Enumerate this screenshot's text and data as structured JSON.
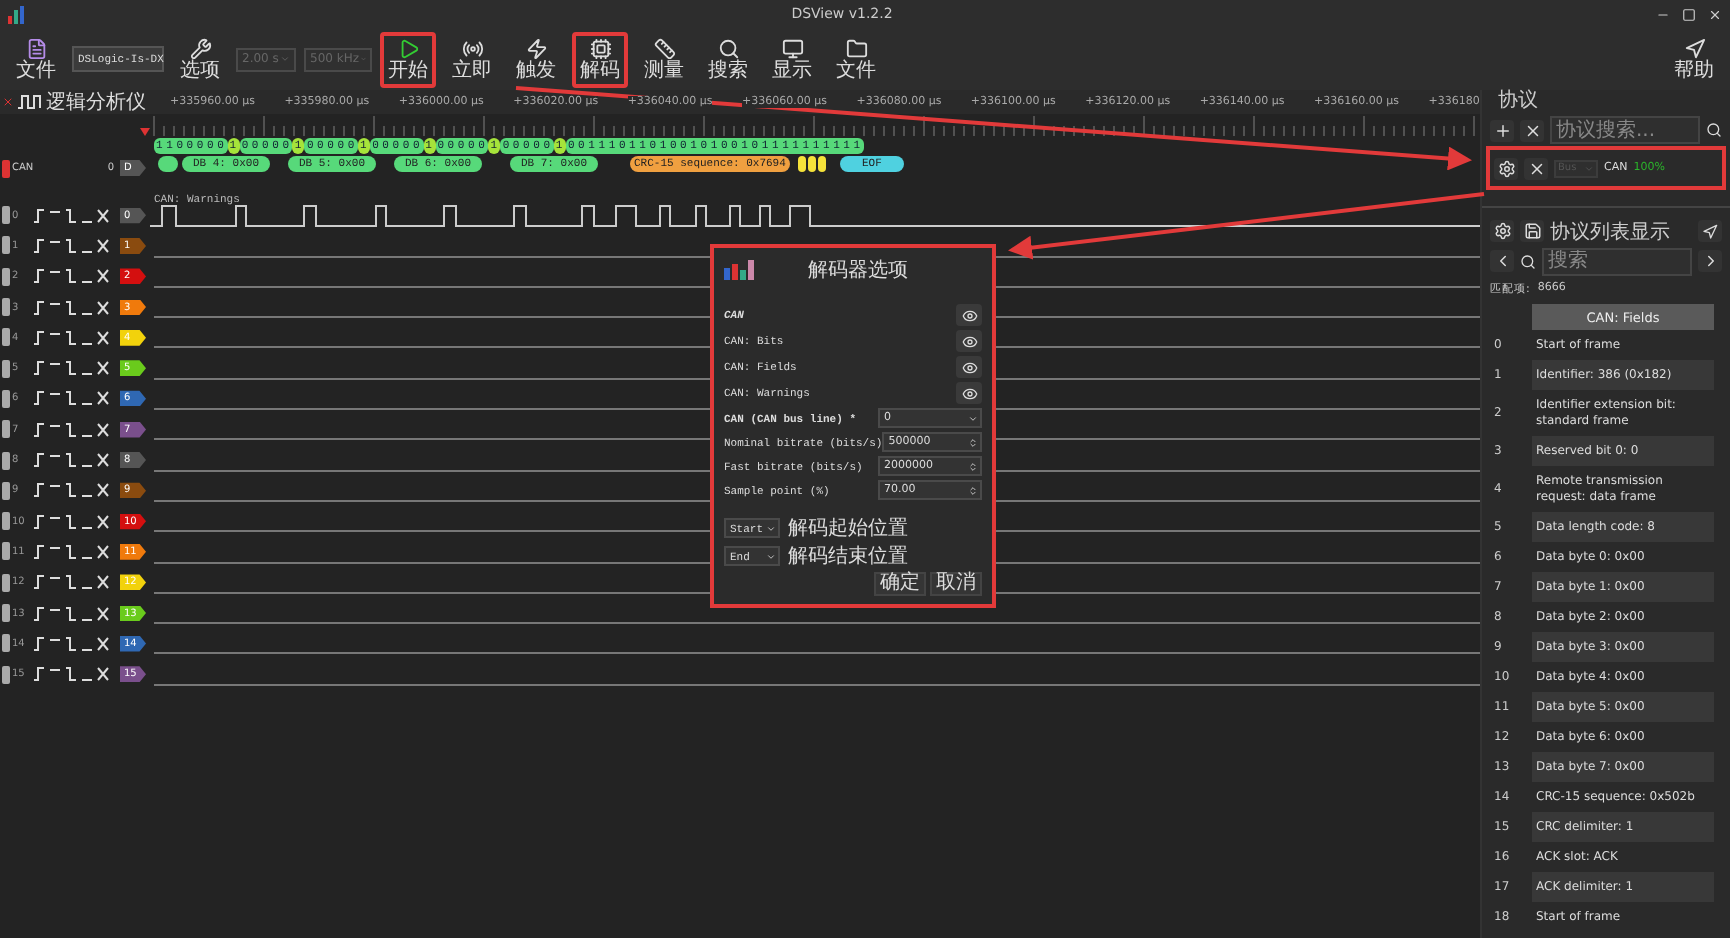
{
  "window": {
    "title": "DSView v1.2.2"
  },
  "toolbar": {
    "file": {
      "label": "文件"
    },
    "device": {
      "value": "DSLogic-Is-DX"
    },
    "options": {
      "label": "选项"
    },
    "duration": {
      "value": "2.00 s",
      "disabled": true
    },
    "rate": {
      "value": "500 kHz",
      "disabled": true
    },
    "buttons": [
      {
        "kind": "start",
        "label": "开始",
        "annotated": true
      },
      {
        "kind": "instant",
        "label": "立即",
        "annotated": false
      },
      {
        "kind": "trigger",
        "label": "触发",
        "annotated": false
      },
      {
        "kind": "decode",
        "label": "解码",
        "annotated": true
      },
      {
        "kind": "measure",
        "label": "测量",
        "annotated": false
      },
      {
        "kind": "search",
        "label": "搜索",
        "annotated": false
      },
      {
        "kind": "display",
        "label": "显示",
        "annotated": false
      },
      {
        "kind": "file",
        "label": "文件",
        "annotated": false
      }
    ],
    "help": {
      "label": "帮助"
    }
  },
  "mode_tab": {
    "label": "逻辑分析仪"
  },
  "ruler": {
    "labels": [
      "+335960.00 μs",
      "+335980.00 μs",
      "+336000.00 μs",
      "+336020.00 μs",
      "+336040.00 μs",
      "+336060.00 μs",
      "+336080.00 μs",
      "+336100.00 μs",
      "+336120.00 μs",
      "+336140.00 μs",
      "+336160.00 μs",
      "+336180"
    ]
  },
  "decoder_trace": {
    "name": "CAN",
    "channel": "0",
    "tag": "D",
    "warnings_label": "CAN: Warnings",
    "bits": [
      {
        "text": "1100000",
        "stuff": false
      },
      {
        "text": "1",
        "stuff": true
      },
      {
        "text": "00000",
        "stuff": false
      },
      {
        "text": "1",
        "stuff": true
      },
      {
        "text": "00000",
        "stuff": false
      },
      {
        "text": "1",
        "stuff": true
      },
      {
        "text": "00000",
        "stuff": false
      },
      {
        "text": "1",
        "stuff": true
      },
      {
        "text": "00000",
        "stuff": false
      },
      {
        "text": "1",
        "stuff": true
      },
      {
        "text": "00000",
        "stuff": false
      },
      {
        "text": "1",
        "stuff": true
      },
      {
        "text": "00111011010010100101111111111",
        "stuff": false
      }
    ],
    "fields": [
      {
        "kind": "dot"
      },
      {
        "kind": "data",
        "text": "DB 4: 0x00"
      },
      {
        "kind": "data",
        "text": "DB 5: 0x00"
      },
      {
        "kind": "data",
        "text": "DB 6: 0x00"
      },
      {
        "kind": "data",
        "text": "DB 7: 0x00"
      },
      {
        "kind": "crc",
        "text": "CRC-15 sequence: 0x7694"
      },
      {
        "kind": "delim"
      },
      {
        "kind": "delim"
      },
      {
        "kind": "delim"
      },
      {
        "kind": "eof",
        "text": "EOF"
      }
    ]
  },
  "channels": [
    {
      "number": "0",
      "tag": "0",
      "color": "#555555",
      "kind": "signal"
    },
    {
      "number": "1",
      "tag": "1",
      "color": "#8a4b0f",
      "kind": "flat"
    },
    {
      "number": "2",
      "tag": "2",
      "color": "#d40f0f",
      "kind": "flat"
    },
    {
      "number": "3",
      "tag": "3",
      "color": "#f07a0c",
      "kind": "flat"
    },
    {
      "number": "4",
      "tag": "4",
      "color": "#f2d20c",
      "kind": "flat"
    },
    {
      "number": "5",
      "tag": "5",
      "color": "#6acb1c",
      "kind": "flat"
    },
    {
      "number": "6",
      "tag": "6",
      "color": "#2f68b3",
      "kind": "flat"
    },
    {
      "number": "7",
      "tag": "7",
      "color": "#7a4f8c",
      "kind": "flat"
    },
    {
      "number": "8",
      "tag": "8",
      "color": "#555555",
      "kind": "flat"
    },
    {
      "number": "9",
      "tag": "9",
      "color": "#8a4b0f",
      "kind": "flat"
    },
    {
      "number": "10",
      "tag": "10",
      "color": "#d40f0f",
      "kind": "flat"
    },
    {
      "number": "11",
      "tag": "11",
      "color": "#f07a0c",
      "kind": "flat"
    },
    {
      "number": "12",
      "tag": "12",
      "color": "#f2d20c",
      "kind": "flat"
    },
    {
      "number": "13",
      "tag": "13",
      "color": "#6acb1c",
      "kind": "flat"
    },
    {
      "number": "14",
      "tag": "14",
      "color": "#2f68b3",
      "kind": "flat"
    },
    {
      "number": "15",
      "tag": "15",
      "color": "#7a4f8c",
      "kind": "flat"
    }
  ],
  "decoder_dialog": {
    "title": "解码器选项",
    "rows": [
      {
        "kind": "header",
        "label": "CAN"
      },
      {
        "kind": "toggle",
        "label": "CAN: Bits"
      },
      {
        "kind": "toggle",
        "label": "CAN: Fields"
      },
      {
        "kind": "toggle",
        "label": "CAN: Warnings"
      },
      {
        "kind": "select",
        "label": "CAN (CAN bus line) *",
        "value": "0"
      },
      {
        "kind": "spin",
        "label": "Nominal bitrate (bits/s)",
        "value": "500000"
      },
      {
        "kind": "spin",
        "label": "Fast bitrate (bits/s)",
        "value": "2000000"
      },
      {
        "kind": "spin",
        "label": "Sample point (%)",
        "value": "70.00"
      }
    ],
    "range": [
      {
        "value": "Start",
        "label": "解码起始位置"
      },
      {
        "value": "End",
        "label": "解码结束位置"
      }
    ],
    "buttons": [
      "确定",
      "取消"
    ]
  },
  "protocol_panel": {
    "title": "协议",
    "search": {
      "placeholder": "协议搜索..."
    },
    "decoder": {
      "select": "Bus",
      "name": "CAN",
      "progress": "100%",
      "finished": true
    },
    "list_title": "协议列表显示",
    "list_search": {
      "placeholder": "搜索"
    },
    "match_label": "匹配项:",
    "match_count": "8666",
    "column": "CAN: Fields",
    "rows": [
      {
        "index": "0",
        "text": "Start of frame"
      },
      {
        "index": "1",
        "text": "Identifier: 386 (0x182)"
      },
      {
        "index": "2",
        "text": "Identifier extension bit: standard frame"
      },
      {
        "index": "3",
        "text": "Reserved bit 0: 0"
      },
      {
        "index": "4",
        "text": "Remote transmission request: data frame"
      },
      {
        "index": "5",
        "text": "Data length code: 8"
      },
      {
        "index": "6",
        "text": "Data byte 0: 0x00"
      },
      {
        "index": "7",
        "text": "Data byte 1: 0x00"
      },
      {
        "index": "8",
        "text": "Data byte 2: 0x00"
      },
      {
        "index": "9",
        "text": "Data byte 3: 0x00"
      },
      {
        "index": "10",
        "text": "Data byte 4: 0x00"
      },
      {
        "index": "11",
        "text": "Data byte 5: 0x00"
      },
      {
        "index": "12",
        "text": "Data byte 6: 0x00"
      },
      {
        "index": "13",
        "text": "Data byte 7: 0x00"
      },
      {
        "index": "14",
        "text": "CRC-15 sequence: 0x502b"
      },
      {
        "index": "15",
        "text": "CRC delimiter: 1"
      },
      {
        "index": "16",
        "text": "ACK slot: ACK"
      },
      {
        "index": "17",
        "text": "ACK delimiter: 1"
      },
      {
        "index": "18",
        "text": "Start of frame"
      }
    ]
  }
}
